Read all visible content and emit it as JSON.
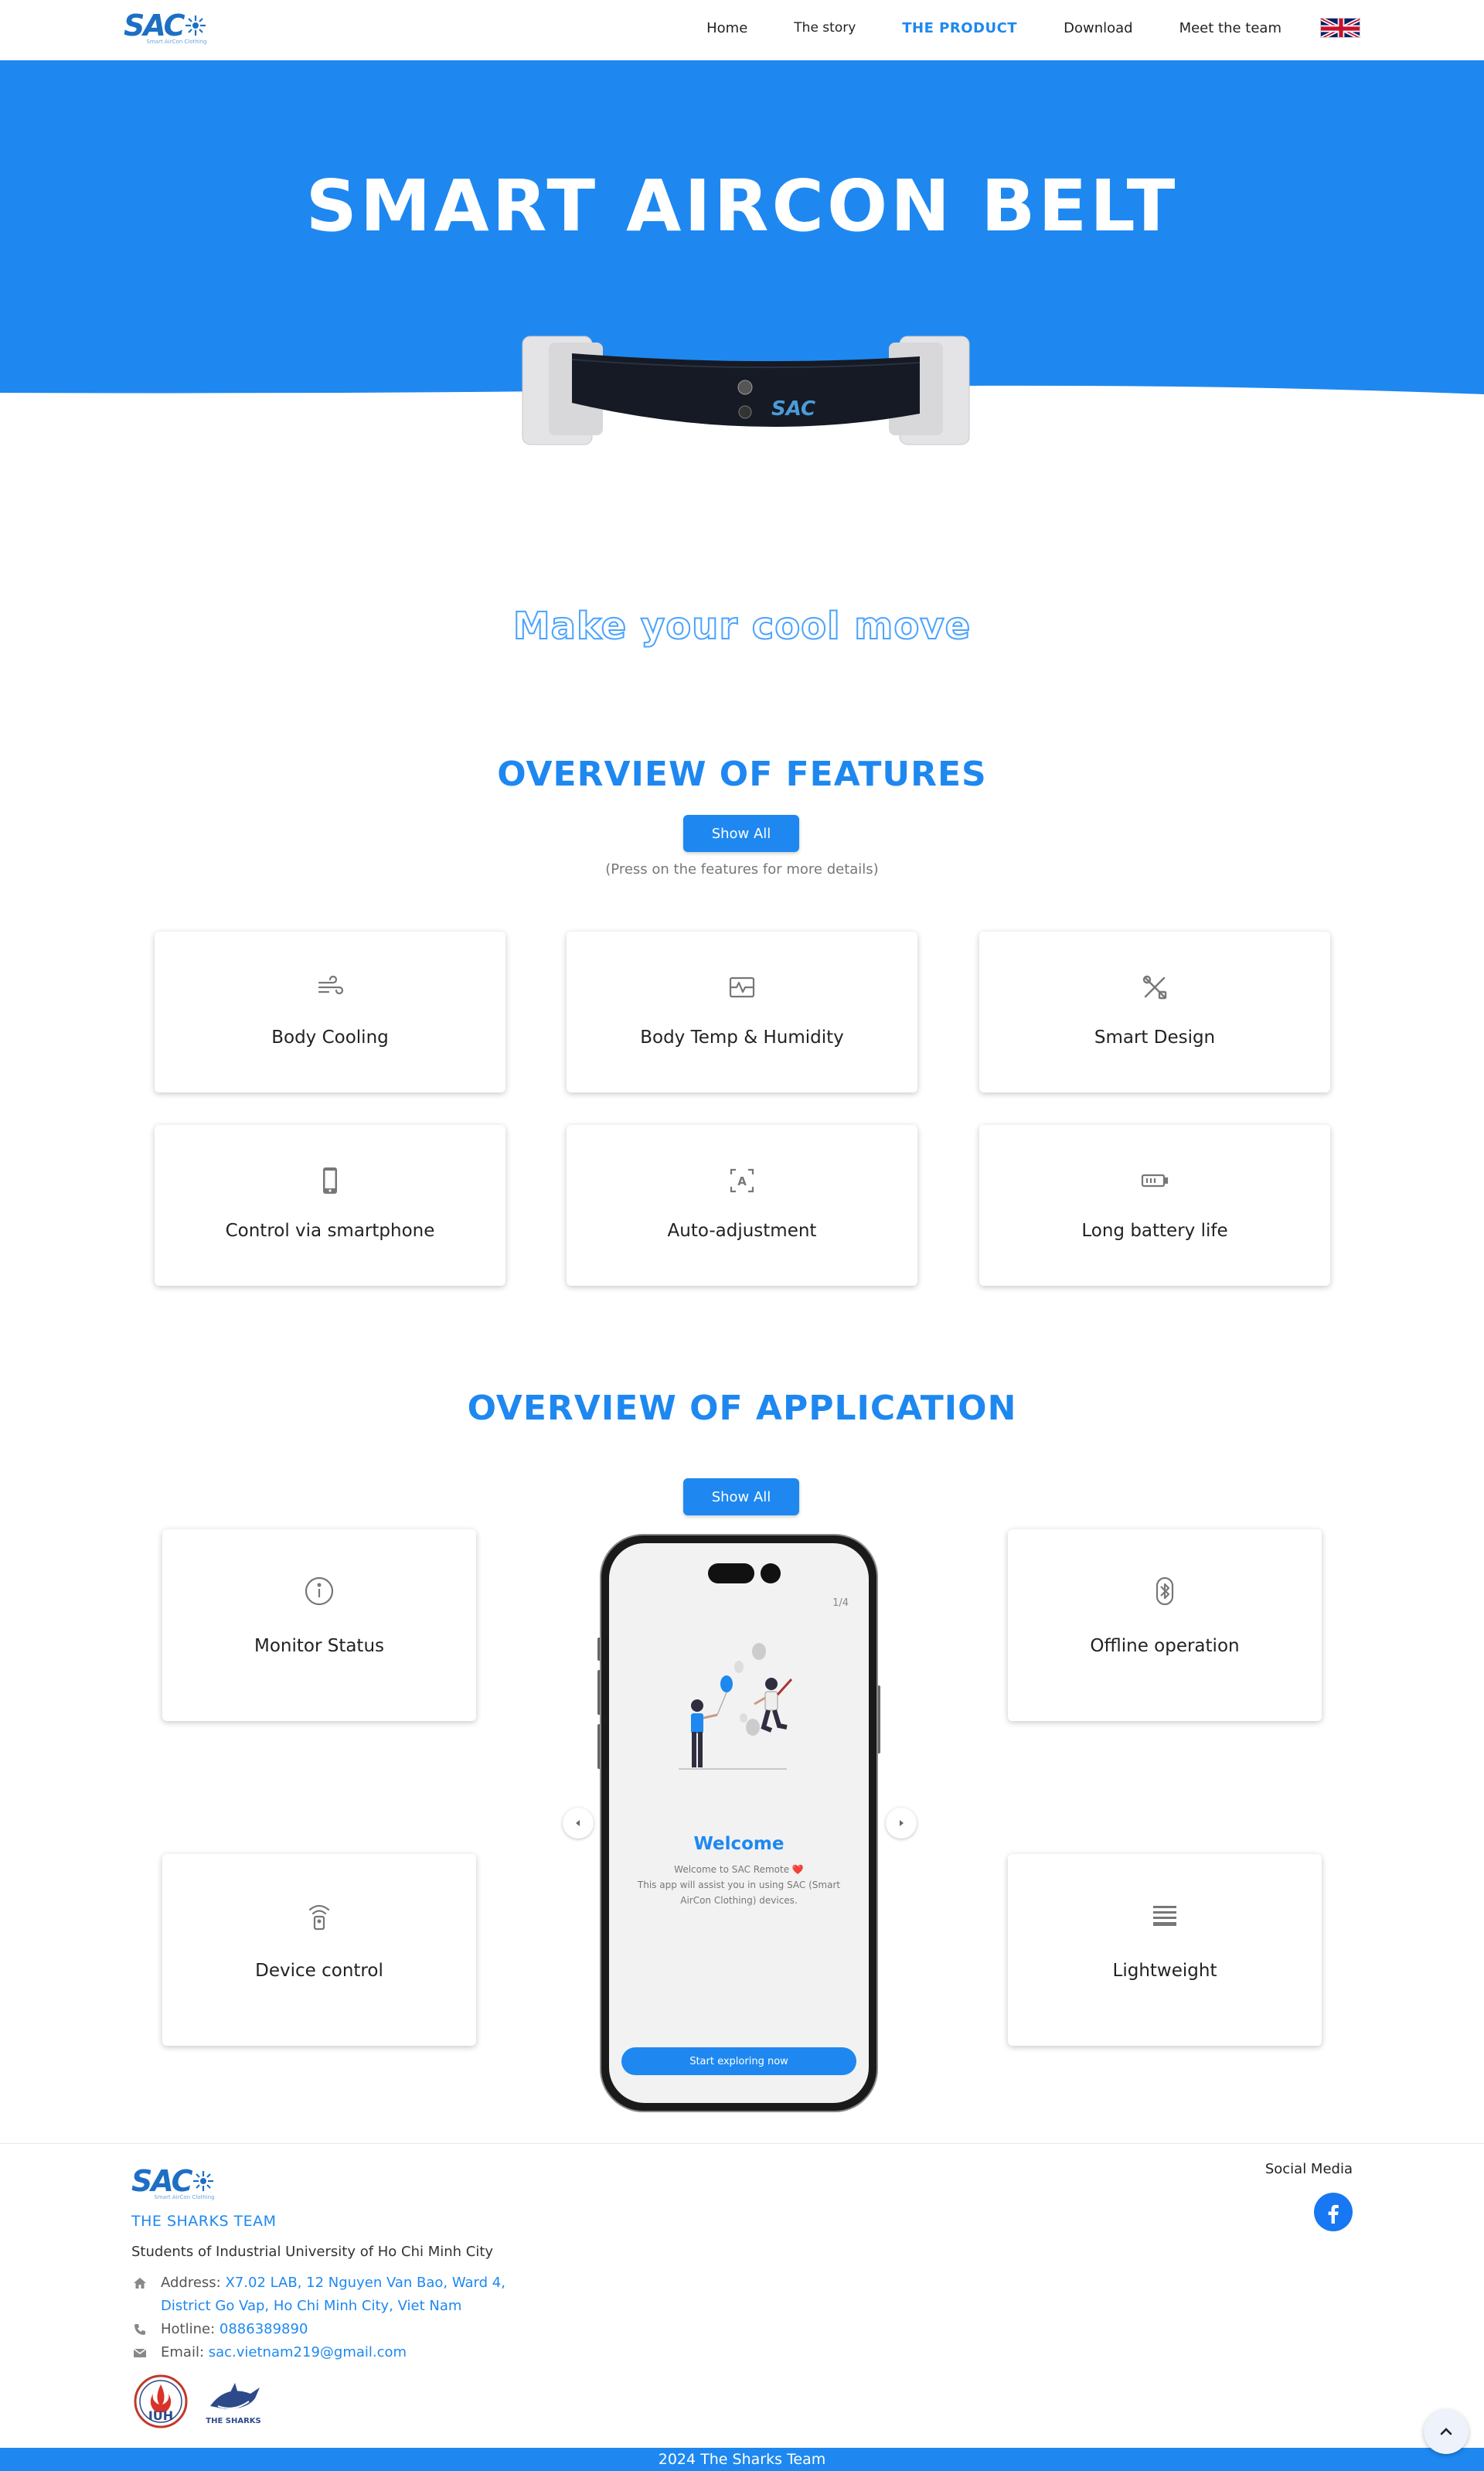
{
  "brand": {
    "logo_text": "SAC",
    "logo_tagline": "Smart AirCon Clothing"
  },
  "nav": {
    "links": [
      "Home",
      "The story",
      "The product",
      "Download",
      "Meet the team"
    ],
    "active_index": 2,
    "language_flag": "uk-flag-icon"
  },
  "hero": {
    "title": "SMART AIRCON BELT",
    "background_color": "#1e88f0",
    "image": "belt-image"
  },
  "tagline": "Make your cool move",
  "features": {
    "title": "OVERVIEW OF FEATURES",
    "show_all_label": "Show All",
    "hint": "(Press on the features for more details)",
    "items": [
      {
        "label": "Body Cooling",
        "icon": "wind-icon"
      },
      {
        "label": "Body Temp & Humidity",
        "icon": "pulse-icon"
      },
      {
        "label": "Smart Design",
        "icon": "tools-icon"
      },
      {
        "label": "Control via smartphone",
        "icon": "smartphone-icon"
      },
      {
        "label": "Auto-adjustment",
        "icon": "auto-icon"
      },
      {
        "label": "Long battery life",
        "icon": "battery-icon"
      }
    ]
  },
  "application": {
    "title": "OVERVIEW OF APPLICATION",
    "show_all_label": "Show All",
    "items": [
      {
        "label": "Monitor Status",
        "icon": "info-icon"
      },
      {
        "label": "Offline operation",
        "icon": "bluetooth-icon"
      },
      {
        "label": "Device control",
        "icon": "remote-icon"
      },
      {
        "label": "Lightweight",
        "icon": "lines-icon"
      }
    ],
    "phone": {
      "page_indicator": "1/4",
      "welcome_title": "Welcome",
      "welcome_line1": "Welcome to SAC Remote ❤️",
      "welcome_line2": "This app will assist you in using SAC (Smart AirCon Clothing) devices.",
      "start_button": "Start exploring now"
    }
  },
  "footer": {
    "team_name": "THE SHARKS TEAM",
    "students": "Students of Industrial University of Ho Chi Minh City",
    "address_label": "Address:",
    "address_value": "X7.02 LAB, 12 Nguyen Van Bao, Ward 4,",
    "address_value2": "District Go Vap, Ho Chi Minh City, Viet Nam",
    "hotline_label": "Hotline:",
    "hotline_value": "0886389890",
    "email_label": "Email:",
    "email_value": "sac.vietnam219@gmail.com",
    "social_title": "Social Media",
    "university_logo_text": "IUH",
    "sharks_logo_text": "THE SHARKS",
    "copyright": "2024 The Sharks Team"
  },
  "colors": {
    "primary": "#1e88f0",
    "logo": "#1d6fc4"
  }
}
